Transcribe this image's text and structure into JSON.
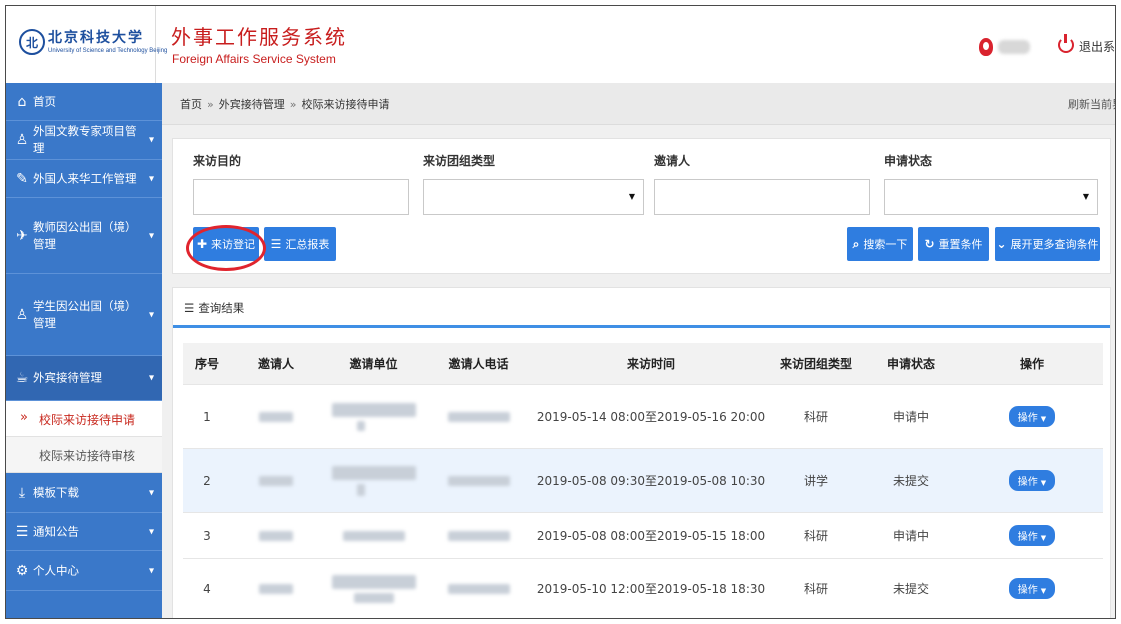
{
  "header": {
    "university_name": "北京科技大学",
    "university_name_en": "University of Science and Technology Beijing",
    "seal_glyph": "北",
    "system_title": "外事工作服务系统",
    "system_subtitle": "Foreign Affairs Service System",
    "logout_label": "退出系统",
    "accent_color": "#c81e1e"
  },
  "sidebar": {
    "bg_color": "#3a78c9",
    "items": [
      {
        "icon": "home-icon",
        "glyph": "⌂",
        "label": "首页",
        "chevron": ""
      },
      {
        "icon": "user-outline-icon",
        "glyph": "♙",
        "label": "外国文教专家项目管理",
        "chevron": "▾"
      },
      {
        "icon": "pen-icon",
        "glyph": "✎",
        "label": "外国人来华工作管理",
        "chevron": "▾"
      },
      {
        "icon": "airplane-icon",
        "glyph": "✈",
        "label": "教师因公出国（境）管理",
        "chevron": "▾"
      },
      {
        "icon": "student-icon",
        "glyph": "♙",
        "label": "学生因公出国（境）管理",
        "chevron": "▾"
      },
      {
        "icon": "cup-icon",
        "glyph": "☕",
        "label": "外宾接待管理",
        "chevron": "▾"
      },
      {
        "icon": "download-icon",
        "glyph": "⤓",
        "label": "模板下载",
        "chevron": "▾"
      },
      {
        "icon": "notice-icon",
        "glyph": "☰",
        "label": "通知公告",
        "chevron": "▾"
      },
      {
        "icon": "settings-icon",
        "glyph": "⚙",
        "label": "个人中心",
        "chevron": "▾"
      }
    ],
    "subitems": [
      {
        "marker": "»",
        "label": "校际来访接待申请"
      },
      {
        "marker": "",
        "label": "校际来访接待审核"
      }
    ]
  },
  "breadcrumb": {
    "items": [
      "首页",
      "外宾接待管理",
      "校际来访接待申请"
    ],
    "separator": "»",
    "refresh_label": "刷新当前界面"
  },
  "filters": {
    "visit_purpose": {
      "label": "来访目的",
      "value": ""
    },
    "group_type": {
      "label": "来访团组类型",
      "value": ""
    },
    "inviter": {
      "label": "邀请人",
      "value": ""
    },
    "status": {
      "label": "申请状态",
      "value": ""
    }
  },
  "actions": {
    "register_label": "来访登记",
    "summary_label": "汇总报表",
    "search_label": "搜索一下",
    "reset_label": "重置条件",
    "expand_label": "展开更多查询条件",
    "button_color": "#2f7de0"
  },
  "results": {
    "title": "查询结果",
    "columns": [
      "序号",
      "邀请人",
      "邀请单位",
      "邀请人电话",
      "来访时间",
      "来访团组类型",
      "申请状态",
      "操作"
    ],
    "rows": [
      {
        "no": "1",
        "time": "2019-05-14 08:00至2019-05-16 20:00",
        "type": "科研",
        "status": "申请中",
        "op": "操作"
      },
      {
        "no": "2",
        "time": "2019-05-08 09:30至2019-05-08 10:30",
        "type": "讲学",
        "status": "未提交",
        "op": "操作"
      },
      {
        "no": "3",
        "time": "2019-05-08 08:00至2019-05-15 18:00",
        "type": "科研",
        "status": "申请中",
        "op": "操作"
      },
      {
        "no": "4",
        "time": "2019-05-10 12:00至2019-05-18 18:30",
        "type": "科研",
        "status": "未提交",
        "op": "操作"
      }
    ]
  }
}
